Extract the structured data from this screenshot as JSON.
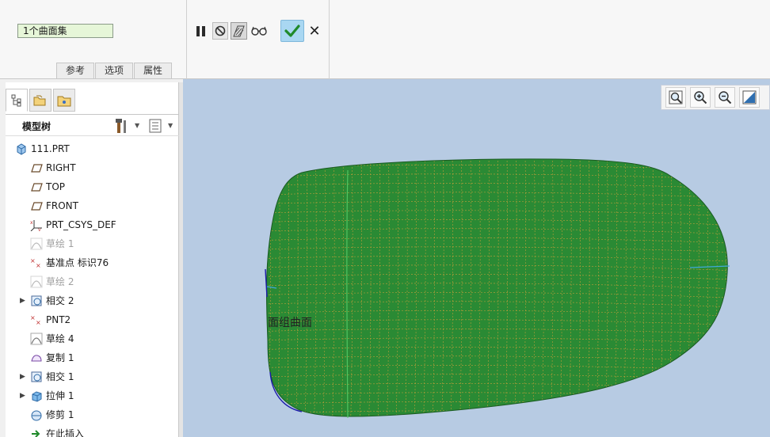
{
  "dashboard": {
    "collector_value": "1个曲面集",
    "tabs": [
      {
        "label": "参考"
      },
      {
        "label": "选项"
      },
      {
        "label": "属性"
      }
    ],
    "toolbar_icons": {
      "pause": "pause-icon",
      "no_preview": "no-preview-icon",
      "attach_geometry": "hatch-preview-icon",
      "verify": "glasses-icon",
      "ok": "checkmark-icon",
      "cancel": "close-icon"
    },
    "cancel_glyph": "✕"
  },
  "model_tree": {
    "panel_tabs": [
      "model-tree-tab-icon",
      "folder-browser-tab-icon",
      "favorites-tab-icon"
    ],
    "title": "模型树",
    "nodes": [
      {
        "label": "111.PRT",
        "icon": "part-icon",
        "expandable": false,
        "dimmed": false
      },
      {
        "label": "RIGHT",
        "icon": "datum-plane-icon",
        "expandable": false,
        "dimmed": false
      },
      {
        "label": "TOP",
        "icon": "datum-plane-icon",
        "expandable": false,
        "dimmed": false
      },
      {
        "label": "FRONT",
        "icon": "datum-plane-icon",
        "expandable": false,
        "dimmed": false
      },
      {
        "label": "PRT_CSYS_DEF",
        "icon": "coordinate-system-icon",
        "expandable": false,
        "dimmed": false
      },
      {
        "label": "草绘 1",
        "icon": "sketch-icon",
        "expandable": false,
        "dimmed": true
      },
      {
        "label": "基准点 标识76",
        "icon": "datum-point-icon",
        "expandable": false,
        "dimmed": false
      },
      {
        "label": "草绘 2",
        "icon": "sketch-icon",
        "expandable": false,
        "dimmed": true
      },
      {
        "label": "相交 2",
        "icon": "intersect-icon",
        "expandable": true,
        "dimmed": false
      },
      {
        "label": "PNT2",
        "icon": "datum-point-icon",
        "expandable": false,
        "dimmed": false
      },
      {
        "label": "草绘 4",
        "icon": "sketch-icon",
        "expandable": false,
        "dimmed": false
      },
      {
        "label": "复制 1",
        "icon": "copy-icon",
        "expandable": false,
        "dimmed": false
      },
      {
        "label": "相交 1",
        "icon": "intersect-icon",
        "expandable": true,
        "dimmed": false
      },
      {
        "label": "拉伸 1",
        "icon": "extrude-icon",
        "expandable": true,
        "dimmed": false
      },
      {
        "label": "修剪 1",
        "icon": "trim-icon",
        "expandable": false,
        "dimmed": false
      },
      {
        "label": "在此插入",
        "icon": "insert-here-icon",
        "expandable": false,
        "dimmed": false
      }
    ]
  },
  "graphics": {
    "view_toolbar": [
      "refit-icon",
      "zoom-in-icon",
      "zoom-out-icon",
      "repaint-icon"
    ],
    "model_label": "面组曲面",
    "colors": {
      "background": "#b7cbe3",
      "surface_fill": "#2a8a34",
      "mesh_lines": "#c9a03a",
      "edge": "#1a1aaa"
    }
  }
}
